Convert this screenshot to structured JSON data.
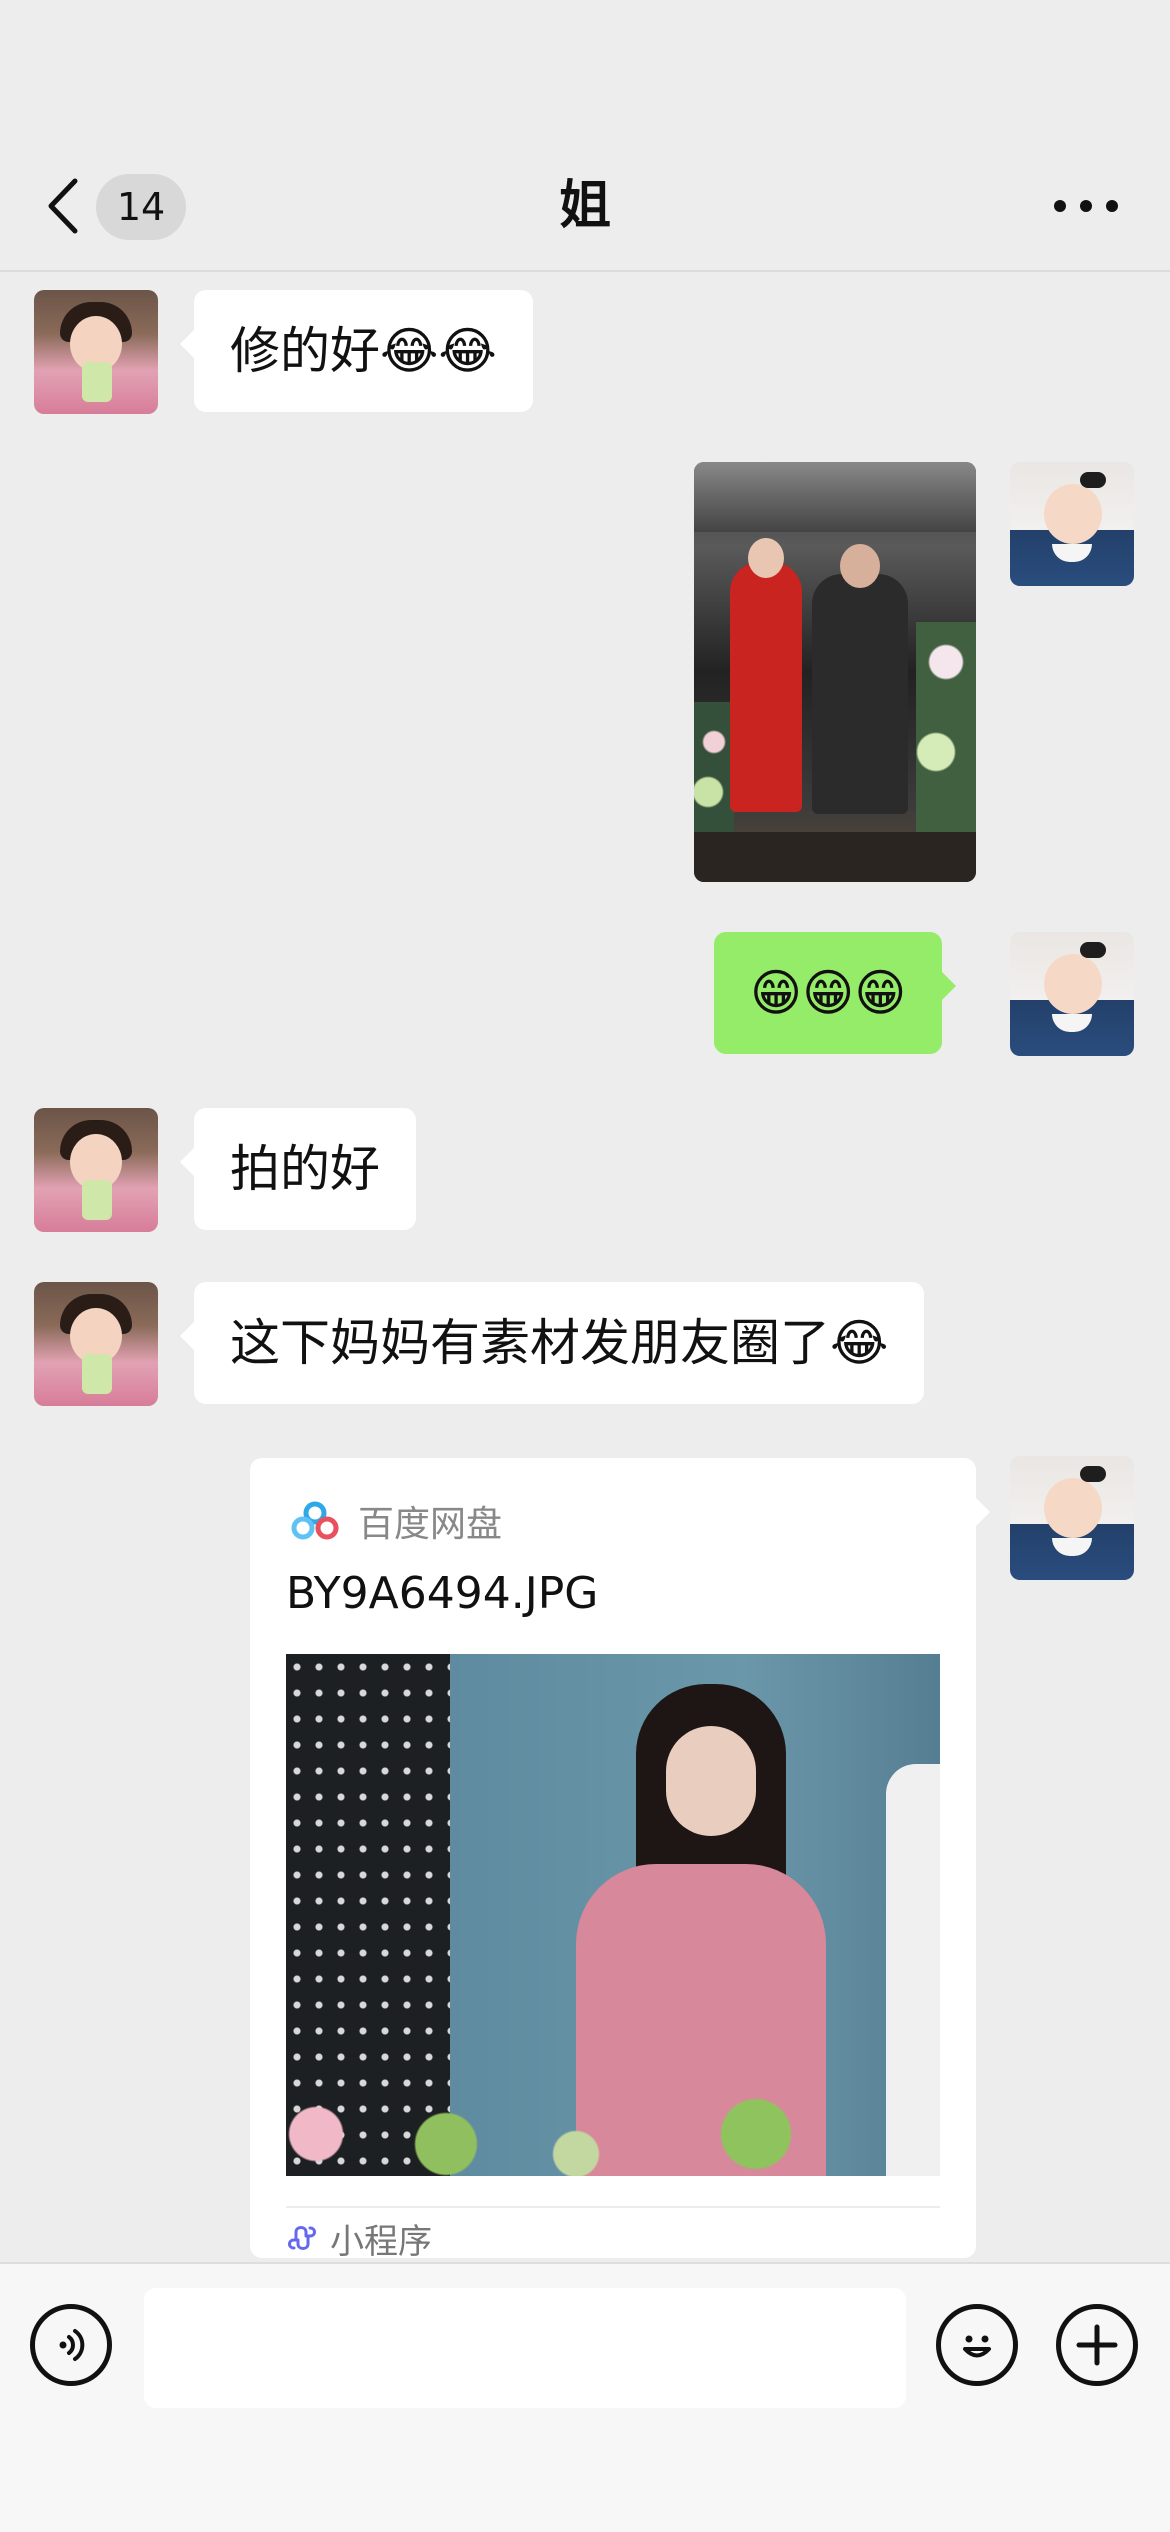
{
  "header": {
    "back_icon": "chevron-left-icon",
    "unread_count": "14",
    "title": "姐",
    "more_icon": "more-dots-icon"
  },
  "messages": [
    {
      "id": 1,
      "side": "left",
      "type": "text",
      "text": "修的好😂😂"
    },
    {
      "id": 2,
      "side": "right",
      "type": "image",
      "description_icon": "photo"
    },
    {
      "id": 3,
      "side": "right",
      "type": "text",
      "text": "😁😁😁"
    },
    {
      "id": 4,
      "side": "left",
      "type": "text",
      "text": "拍的好"
    },
    {
      "id": 5,
      "side": "left",
      "type": "text",
      "text": "这下妈妈有素材发朋友圈了😂"
    },
    {
      "id": 6,
      "side": "right",
      "type": "card",
      "source": "百度网盘",
      "title": "BY9A6494.JPG",
      "footer": "小程序"
    }
  ],
  "input_bar": {
    "voice_icon": "voice-icon",
    "input_value": "",
    "emoji_icon": "emoji-icon",
    "plus_icon": "plus-icon"
  },
  "colors": {
    "background": "#ededed",
    "bubble_sent": "#95ec69",
    "bubble_received": "#ffffff"
  }
}
